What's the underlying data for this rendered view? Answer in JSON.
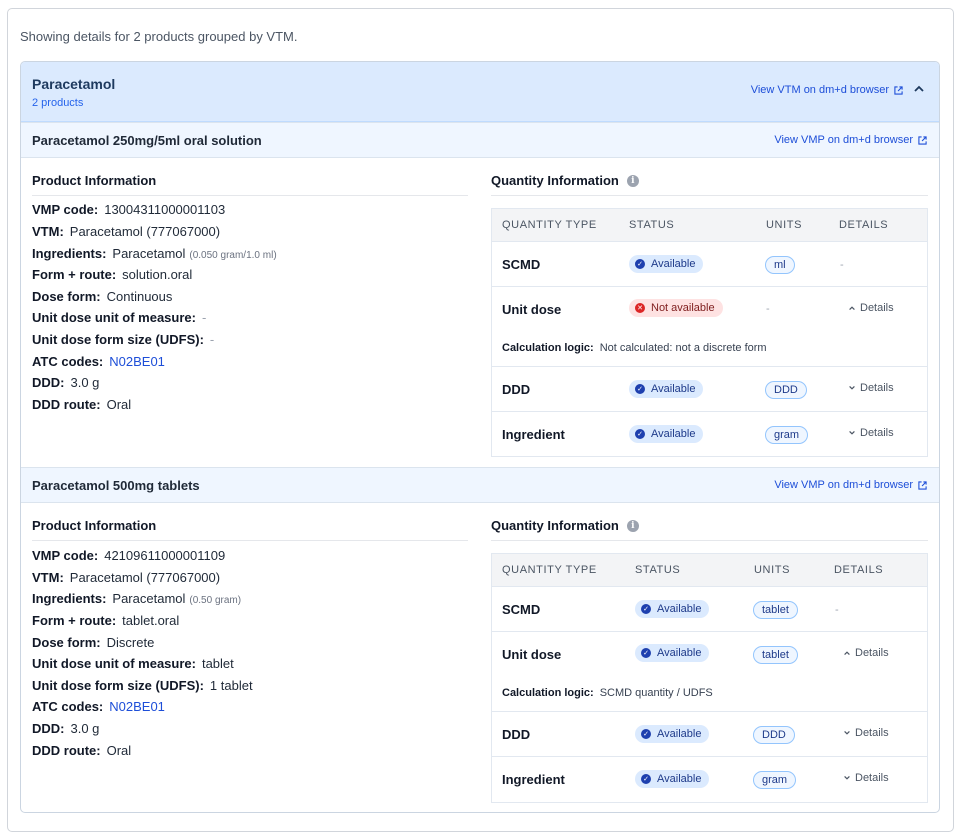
{
  "intro": "Showing details for 2 products grouped by VTM.",
  "vtm": {
    "title": "Paracetamol",
    "subtitle": "2 products",
    "link": "View VTM on dm+d browser"
  },
  "products": [
    {
      "title": "Paracetamol 250mg/5ml oral solution",
      "link": "View VMP on dm+d browser",
      "product_info_title": "Product Information",
      "vmp_code_label": "VMP code:",
      "vmp_code": "13004311000001103",
      "vtm_label": "VTM:",
      "vtm": "Paracetamol (777067000)",
      "ingredients_label": "Ingredients:",
      "ingredients": "Paracetamol",
      "ingredients_strength": "(0.050 gram/1.0 ml)",
      "form_route_label": "Form + route:",
      "form_route": "solution.oral",
      "dose_form_label": "Dose form:",
      "dose_form": "Continuous",
      "udu_label": "Unit dose unit of measure:",
      "udu": "-",
      "udfs_label": "Unit dose form size (UDFS):",
      "udfs": "-",
      "atc_label": "ATC codes:",
      "atc": "N02BE01",
      "ddd_label": "DDD:",
      "ddd": "3.0 g",
      "ddd_route_label": "DDD route:",
      "ddd_route": "Oral",
      "quantity_title": "Quantity Information",
      "headers": [
        "QUANTITY TYPE",
        "STATUS",
        "UNITS",
        "DETAILS"
      ],
      "rows": [
        {
          "type": "SCMD",
          "status": "Available",
          "unit": "ml",
          "details": "-"
        },
        {
          "type": "Unit dose",
          "status": "Not available",
          "unit": "-",
          "details": "Details",
          "calc_label": "Calculation logic:",
          "calc": "Not calculated: not a discrete form"
        },
        {
          "type": "DDD",
          "status": "Available",
          "unit": "DDD",
          "details": "Details"
        },
        {
          "type": "Ingredient",
          "status": "Available",
          "unit": "gram",
          "details": "Details"
        }
      ]
    },
    {
      "title": "Paracetamol 500mg tablets",
      "link": "View VMP on dm+d browser",
      "product_info_title": "Product Information",
      "vmp_code_label": "VMP code:",
      "vmp_code": "42109611000001109",
      "vtm_label": "VTM:",
      "vtm": "Paracetamol (777067000)",
      "ingredients_label": "Ingredients:",
      "ingredients": "Paracetamol",
      "ingredients_strength": "(0.50 gram)",
      "form_route_label": "Form + route:",
      "form_route": "tablet.oral",
      "dose_form_label": "Dose form:",
      "dose_form": "Discrete",
      "udu_label": "Unit dose unit of measure:",
      "udu": "tablet",
      "udfs_label": "Unit dose form size (UDFS):",
      "udfs": "1 tablet",
      "atc_label": "ATC codes:",
      "atc": "N02BE01",
      "ddd_label": "DDD:",
      "ddd": "3.0 g",
      "ddd_route_label": "DDD route:",
      "ddd_route": "Oral",
      "quantity_title": "Quantity Information",
      "headers": [
        "QUANTITY TYPE",
        "STATUS",
        "UNITS",
        "DETAILS"
      ],
      "rows": [
        {
          "type": "SCMD",
          "status": "Available",
          "unit": "tablet",
          "details": "-"
        },
        {
          "type": "Unit dose",
          "status": "Available",
          "unit": "tablet",
          "details": "Details",
          "calc_label": "Calculation logic:",
          "calc": "SCMD quantity / UDFS"
        },
        {
          "type": "DDD",
          "status": "Available",
          "unit": "DDD",
          "details": "Details"
        },
        {
          "type": "Ingredient",
          "status": "Available",
          "unit": "gram",
          "details": "Details"
        }
      ]
    }
  ],
  "colors": {
    "accent": "#1d4ed8",
    "header_bg": "#dbeafe",
    "available": "#dbeafe",
    "not_available": "#fee2e2"
  }
}
